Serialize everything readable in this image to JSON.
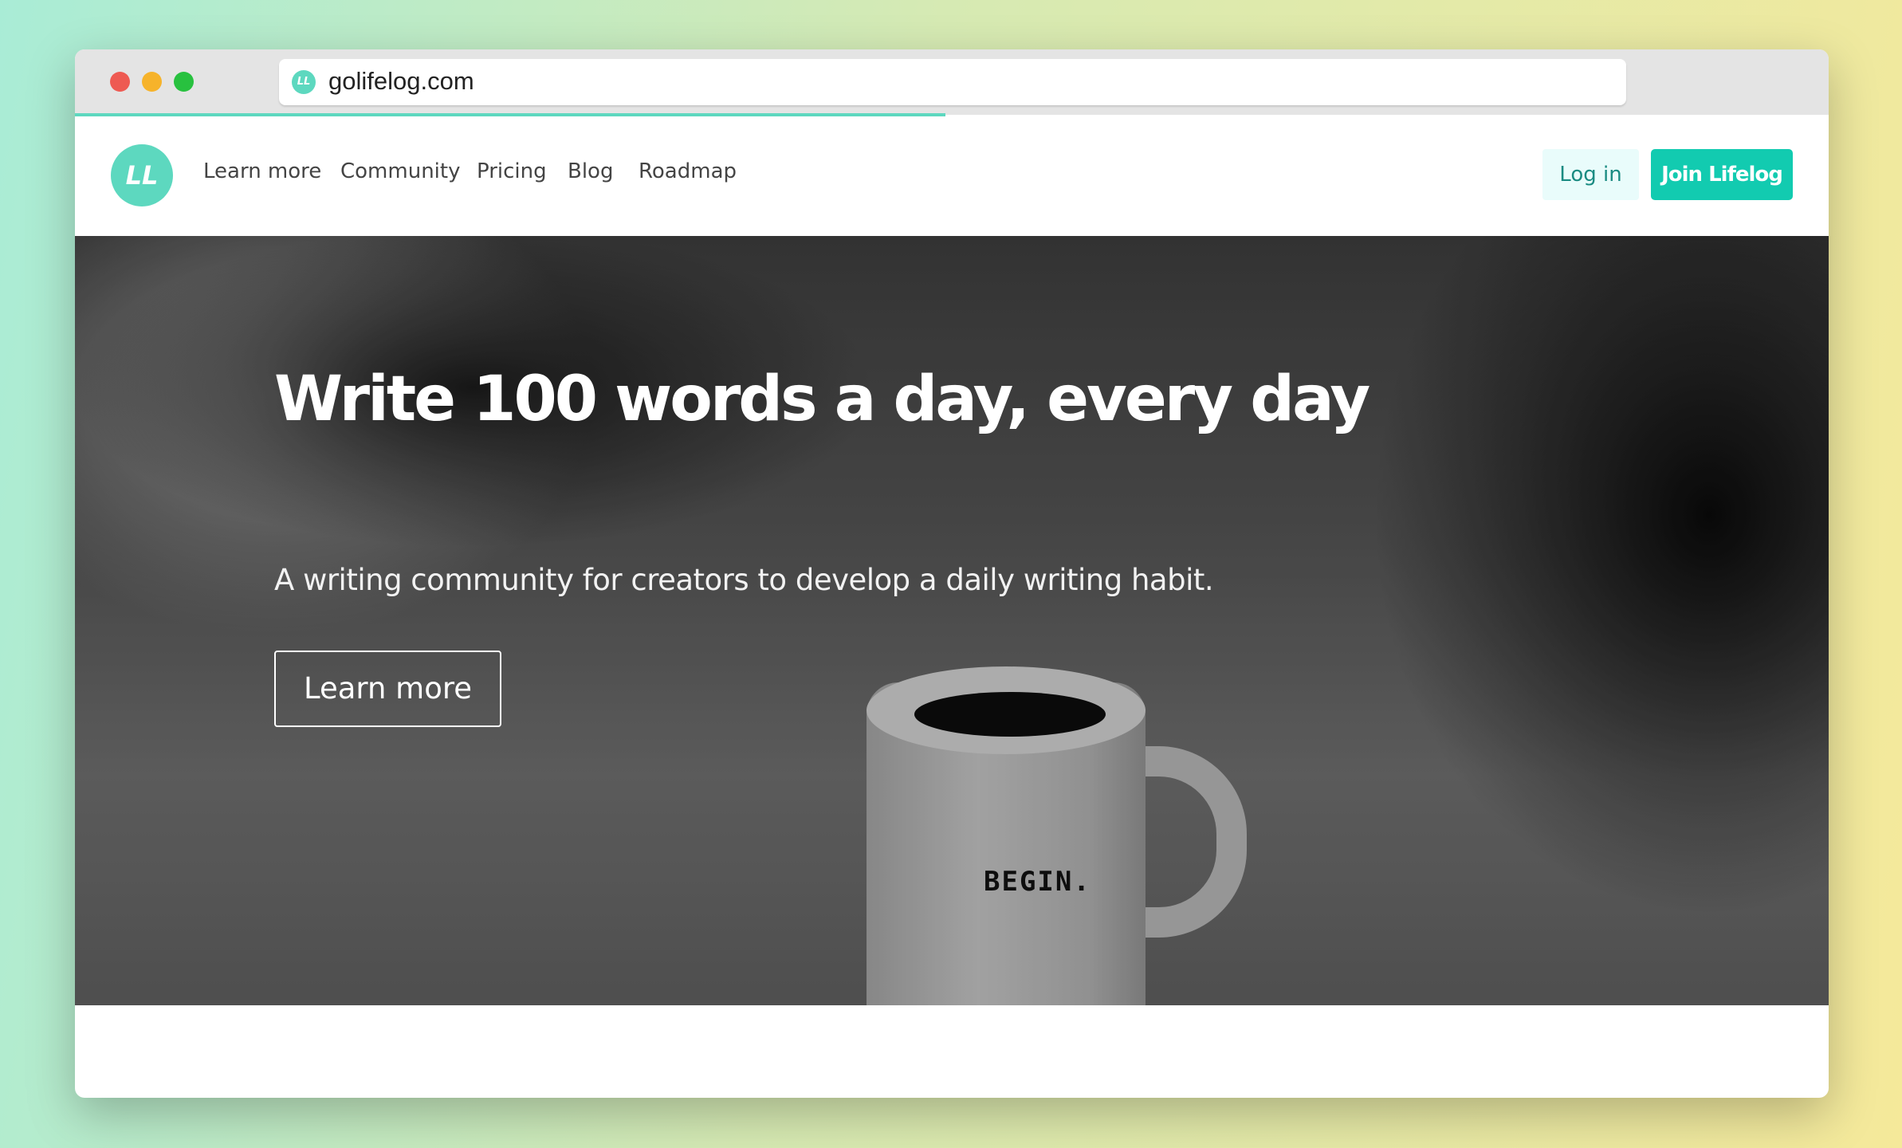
{
  "browser": {
    "url": "golifelog.com",
    "load_progress_percent": 50
  },
  "brand": {
    "logo_text": "LL",
    "accent_color": "#5dd8bf",
    "button_color": "#12cbb0"
  },
  "nav": {
    "links": [
      {
        "label": "Learn more"
      },
      {
        "label": "Community"
      },
      {
        "label": "Pricing"
      },
      {
        "label": "Blog"
      },
      {
        "label": "Roadmap"
      }
    ],
    "login_label": "Log in",
    "join_label": "Join Lifelog"
  },
  "hero": {
    "title": "Write 100 words a day, every day",
    "subtitle": "A writing community for creators to develop a daily writing habit.",
    "cta_label": "Learn more",
    "image_text": "BEGIN."
  }
}
